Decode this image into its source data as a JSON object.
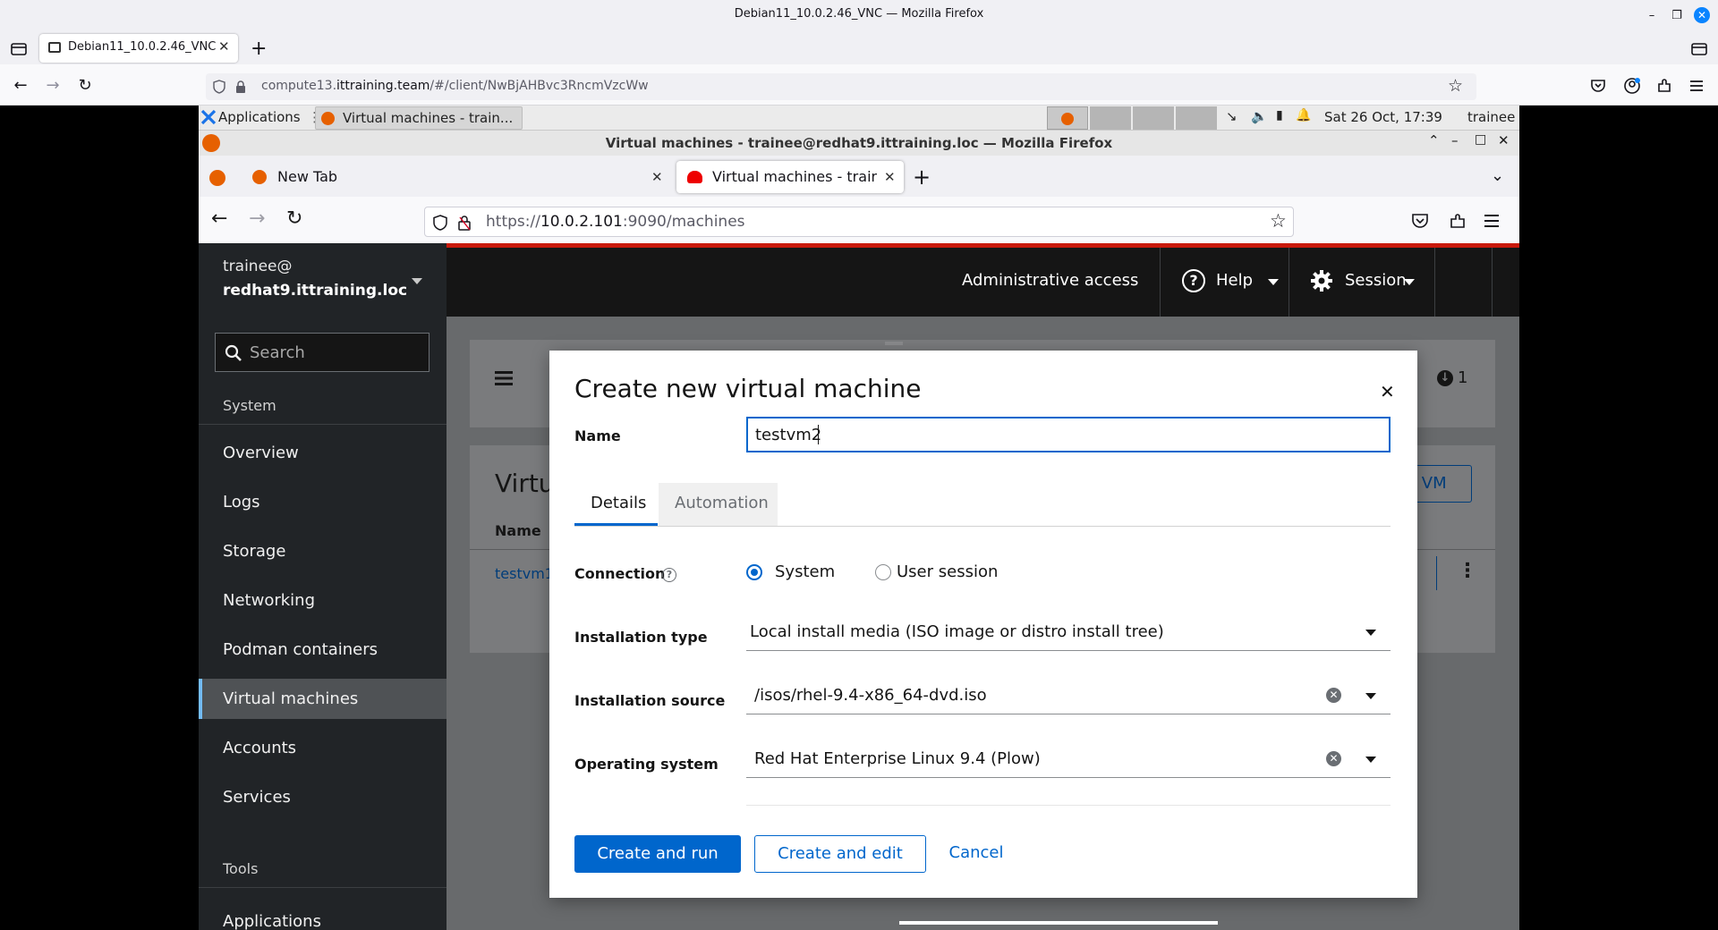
{
  "outer_window": {
    "title": "Debian11_10.0.2.46_VNC — Mozilla Firefox",
    "tab_label": "Debian11_10.0.2.46_VNC",
    "url_host": "compute13.",
    "url_domain": "ittraining.team",
    "url_path": "/#/client/NwBjAHBvc3RncmVzcWw"
  },
  "xfce_panel": {
    "applications_label": "Applications",
    "task_label": "Virtual machines - train...",
    "clock": "Sat 26 Oct, 17:39",
    "user": "trainee"
  },
  "inner_window": {
    "title": "Virtual machines - trainee@redhat9.ittraining.loc — Mozilla Firefox",
    "tabs": [
      {
        "label": "New Tab"
      },
      {
        "label": "Virtual machines - trainee"
      }
    ],
    "url_scheme": "https://",
    "url_host": "10.0.2.101",
    "url_rest": ":9090/machines"
  },
  "cockpit": {
    "host_user": "trainee@",
    "host_name": "redhat9.ittraining.loc",
    "search_placeholder": "Search",
    "section_system": "System",
    "nav_items": [
      {
        "label": "Overview"
      },
      {
        "label": "Logs"
      },
      {
        "label": "Storage"
      },
      {
        "label": "Networking"
      },
      {
        "label": "Podman containers"
      },
      {
        "label": "Virtual machines"
      },
      {
        "label": "Accounts"
      },
      {
        "label": "Services"
      }
    ],
    "active_nav": "Virtual machines",
    "section_tools": "Tools",
    "tools_first": "Applications",
    "topbar": {
      "admin_access": "Administrative access",
      "help": "Help",
      "session": "Session"
    },
    "background": {
      "heading_partial": "Virtu",
      "col_name": "Name",
      "row_vm": "testvm1",
      "create_vm_partial": "e VM",
      "downloads_count": "1"
    }
  },
  "modal": {
    "title": "Create new virtual machine",
    "name_label": "Name",
    "name_value": "testvm2",
    "tabs": [
      {
        "label": "Details",
        "active": true
      },
      {
        "label": "Automation",
        "active": false
      }
    ],
    "connection_label": "Connection",
    "connection_options": [
      {
        "label": "System",
        "selected": true
      },
      {
        "label": "User session",
        "selected": false
      }
    ],
    "install_type_label": "Installation type",
    "install_type_value": "Local install media (ISO image or distro install tree)",
    "install_source_label": "Installation source",
    "install_source_value": "/isos/rhel-9.4-x86_64-dvd.iso",
    "os_label": "Operating system",
    "os_value": "Red Hat Enterprise Linux 9.4 (Plow)",
    "buttons": {
      "create_run": "Create and run",
      "create_edit": "Create and edit",
      "cancel": "Cancel"
    }
  },
  "colors": {
    "primary_blue": "#0066cc",
    "cockpit_sidebar": "#212427",
    "cockpit_topbar": "#151515",
    "accent_red": "#c9190b"
  }
}
